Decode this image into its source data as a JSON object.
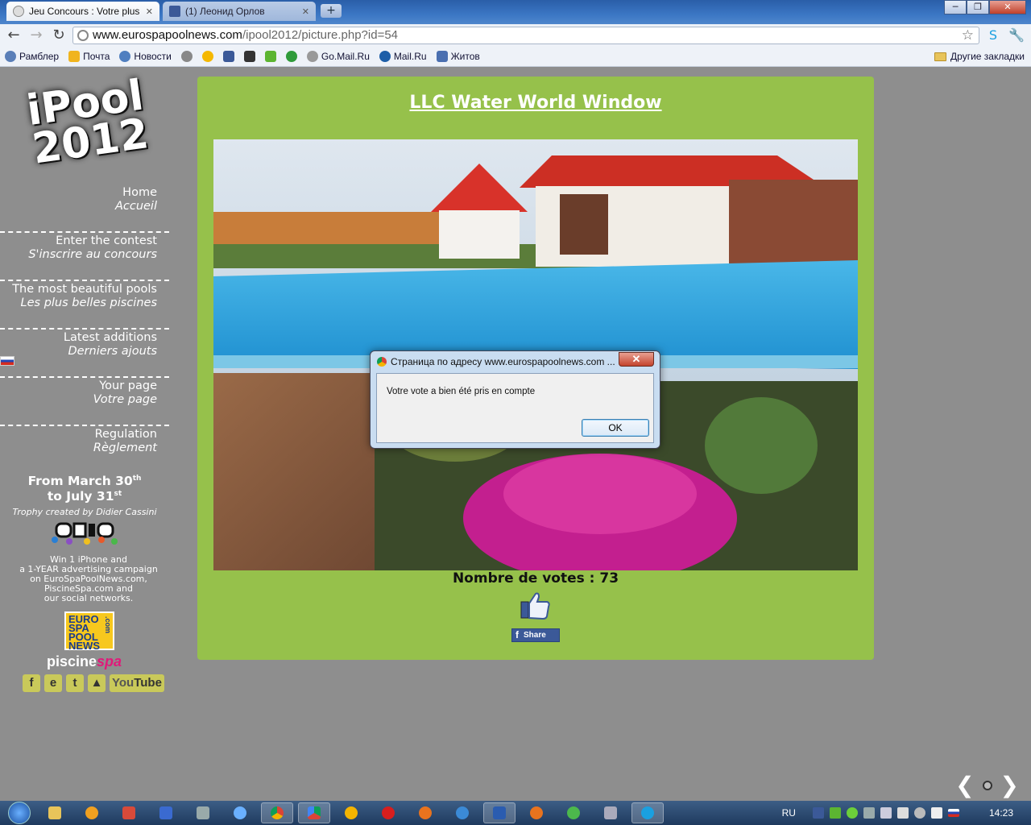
{
  "browser": {
    "tabs": [
      {
        "title": "Jeu Concours : Votre plus b",
        "active": true
      },
      {
        "title": "(1) Леонид Орлов",
        "active": false
      }
    ],
    "url_domain": "www.eurospapoolnews.com",
    "url_path": "/ipool2012/picture.php?id=54",
    "bookmarks": [
      "Рамблер",
      "Почта",
      "Новости",
      "Go.Mail.Ru",
      "Mail.Ru",
      "Житов"
    ],
    "other_bookmarks": "Другие закладки"
  },
  "sidebar": {
    "logo_line1": "iPool",
    "logo_line2": "2012",
    "nav": [
      {
        "en": "Home",
        "fr": "Accueil"
      },
      {
        "en": "Enter the contest",
        "fr": "S'inscrire au concours"
      },
      {
        "en": "The most beautiful pools",
        "fr": "Les plus belles piscines"
      },
      {
        "en": "Latest additions",
        "fr": "Derniers ajouts"
      },
      {
        "en": "Your page",
        "fr": "Votre page"
      },
      {
        "en": "Regulation",
        "fr": "Règlement"
      }
    ],
    "dates_line1": "From March 30",
    "dates_sup1": "th",
    "dates_line2": "to July 31",
    "dates_sup2": "st",
    "trophy": "Trophy created by Didier Cassini",
    "win_lines": [
      "Win 1 iPhone and",
      "a 1-YEAR advertising campaign",
      "on EuroSpaPoolNews.com,",
      "PiscineSpa.com and",
      "our social networks."
    ],
    "esp_logo_lines": [
      "EURO",
      "SPA",
      "POOL",
      "NEWS"
    ],
    "esp_logo_side": ".com",
    "piscine": "piscine",
    "spa": "spa",
    "youtube_you": "You",
    "youtube_tube": "Tube"
  },
  "main": {
    "title": "LLC Water World Window",
    "votes": "Nombre de votes : 73",
    "share_label": "Share"
  },
  "dialog": {
    "title": "Страница по адресу www.eurospapoolnews.com ...",
    "message": "Votre vote a bien été pris en compte",
    "ok": "OK"
  },
  "taskbar": {
    "lang": "RU",
    "time": "14:23"
  }
}
